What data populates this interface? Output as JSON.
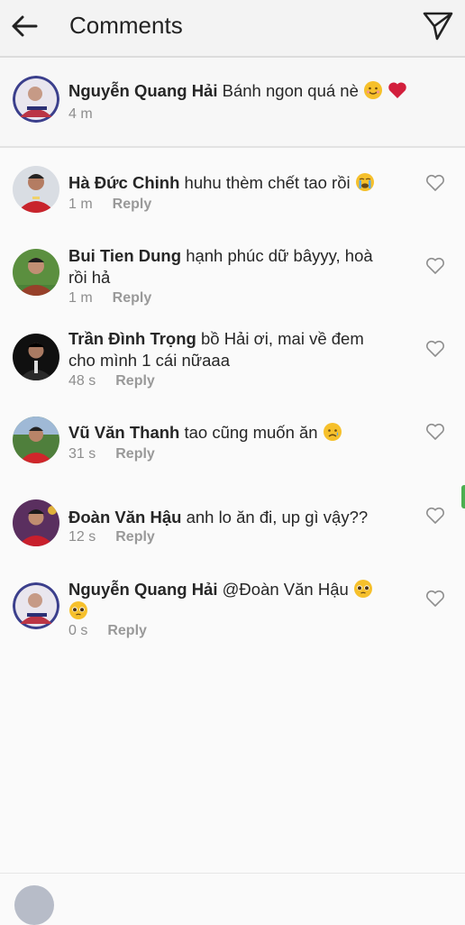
{
  "header": {
    "title": "Comments"
  },
  "caption": {
    "username": "Nguyễn Quang Hải",
    "text": "Bánh ngon quá nè",
    "time": "4 m"
  },
  "comments": [
    {
      "username": "Hà Đức Chinh",
      "text": "huhu thèm chết tao rồi",
      "time": "1 m",
      "reply": "Reply"
    },
    {
      "username": "Bui Tien Dung",
      "text": "hạnh phúc dữ bâyyy, hoà",
      "text2": "rồi hả",
      "time": "1 m",
      "reply": "Reply"
    },
    {
      "username": "Trần Đình Trọng",
      "text": "bồ Hải ơi, mai về đem",
      "text2": "cho mình 1 cái nữaaa",
      "time": "48 s",
      "reply": "Reply"
    },
    {
      "username": "Vũ Văn Thanh",
      "text": "tao cũng muốn ăn",
      "time": "31 s",
      "reply": "Reply"
    },
    {
      "username": "Đoàn Văn Hậu",
      "text": "anh lo ăn đi, up gì vậy??",
      "time": "12 s",
      "reply": "Reply"
    },
    {
      "username": "Nguyễn Quang Hải",
      "text": "@Đoàn Văn Hậu",
      "time": "0 s",
      "reply": "Reply"
    }
  ],
  "icons": {
    "back": "arrow-left-icon",
    "send": "paper-plane-icon",
    "like": "heart-outline-icon"
  },
  "colors": {
    "meta": "#8e8e8e",
    "heart": "#d21f3c"
  }
}
